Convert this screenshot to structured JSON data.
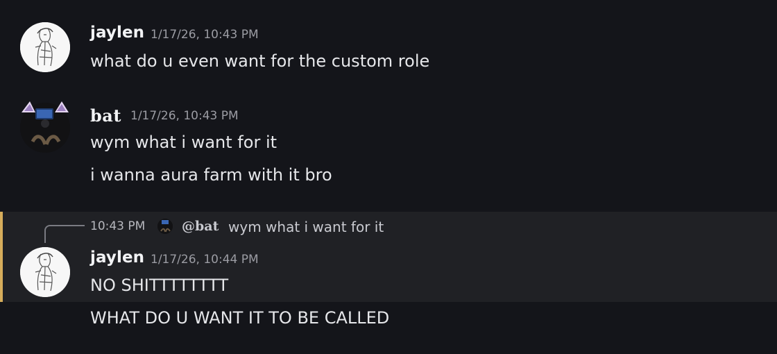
{
  "messages": [
    {
      "author": "jaylen",
      "timestamp": "1/17/26, 10:43 PM",
      "lines": [
        "what do u even want for the custom role"
      ]
    },
    {
      "author": "bat",
      "timestamp": "1/17/26, 10:43 PM",
      "lines": [
        "wym what i want for it",
        "i wanna aura farm with it bro"
      ]
    },
    {
      "reply": {
        "time": "10:43 PM",
        "author": "@bat",
        "text": "wym what i want for it"
      },
      "author": "jaylen",
      "timestamp": "1/17/26, 10:44 PM",
      "lines": [
        "NO SHITTTTTTTT",
        "WHAT DO U WANT IT TO BE CALLED"
      ]
    }
  ],
  "colors": {
    "background": "#14151a",
    "highlight": "#202125",
    "highlight_accent": "#d6ad5b",
    "timestamp": "#9b9ca3",
    "text": "#e6e7ea"
  },
  "icons": {
    "avatar_jaylen": "sketch-character-avatar",
    "avatar_bat": "cat-ear-avatar"
  }
}
